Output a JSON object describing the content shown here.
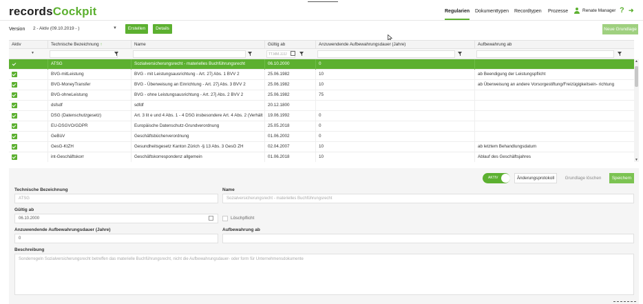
{
  "app": {
    "logo_part1": "records",
    "logo_part2": "Cockpit",
    "nav": [
      {
        "label": "Regularien",
        "active": true
      },
      {
        "label": "Dokumenttypen",
        "active": false
      },
      {
        "label": "Recordtypen",
        "active": false
      },
      {
        "label": "Prozesse",
        "active": false
      }
    ],
    "user_name": "Renate Manager"
  },
  "toolbar": {
    "version_label": "Version",
    "version_value": "2 - Aktiv (09.10.2019 - )",
    "create_label": "Erstellen",
    "details_label": "Details",
    "new_template_label": "Neue Grundlage"
  },
  "grid": {
    "columns": [
      {
        "label": "Aktiv"
      },
      {
        "label": "Technische Bezeichnung"
      },
      {
        "label": "Name"
      },
      {
        "label": "Gültig ab"
      },
      {
        "label": "Anzuwendende Aufbewahrungsdauer (Jahre)"
      },
      {
        "label": "Aufbewahrung ab"
      }
    ],
    "date_filter_placeholder": "TT.MM.JJJJ",
    "rows": [
      {
        "tech": "ATSG",
        "name": "Sozialversicherungsrecht - materielles Buchführungsrecht",
        "valid": "06.10.2000",
        "years": "0",
        "from": "",
        "selected": true
      },
      {
        "tech": "BVG-mitLeistung",
        "name": "BVG - mit Leistungsausrichtung - Art. 27j Abs. 1 BVV 2",
        "valid": "25.06.1982",
        "years": "10",
        "from": "ab Beendigung der Leistungspflicht",
        "selected": false
      },
      {
        "tech": "BVG-MoneyTransfer",
        "name": "BVG - Überweisung an Einrichtung - Art. 27j Abs. 3 BVV 2",
        "valid": "25.06.1982",
        "years": "10",
        "from": "ab Überweisung an andere Vorsorgestiftung/Freizügigkeitsein- richtung",
        "selected": false
      },
      {
        "tech": "BVG-ohneLeistung",
        "name": "BVG - ohne Leistungsausrichtung - Art. 27j Abs. 2 BVV 2",
        "valid": "25.06.1982",
        "years": "75",
        "from": "",
        "selected": false
      },
      {
        "tech": "dsfsdf",
        "name": "sdfdf",
        "valid": "20.12.1800",
        "years": "",
        "from": "",
        "selected": false
      },
      {
        "tech": "DSG (Datenschutzgesetz)",
        "name": "Art. 3 lit e und 4 Abs. 1 - 4 DSG insbesondere Art. 4 Abs. 2 (Verhält",
        "valid": "19.06.1992",
        "years": "0",
        "from": "",
        "selected": false
      },
      {
        "tech": "EU-DSGVO/GDPR",
        "name": "Europäische Datenschutz-Grundverordnung",
        "valid": "25.05.2018",
        "years": "0",
        "from": "",
        "selected": false
      },
      {
        "tech": "GeBüV",
        "name": "Geschäftsbücherverordnung",
        "valid": "01.06.2002",
        "years": "0",
        "from": "",
        "selected": false
      },
      {
        "tech": "GesG-KtZH",
        "name": "Gesundheitsgesetz Kanton Zürich -§ 13 Abs. 3 GesG ZH",
        "valid": "02.04.2007",
        "years": "10",
        "from": "ab letztem Behandlungsdatum",
        "selected": false
      },
      {
        "tech": "int-Geschäftskorr",
        "name": "Geschäftskorrespondenz allgemein",
        "valid": "01.06.2018",
        "years": "10",
        "from": "Ablauf des Geschäftsjahres",
        "selected": false
      }
    ]
  },
  "detail": {
    "toggle_label": "AKTIV",
    "protocol_label": "Änderungsprotokoll",
    "delete_label": "Grundlage löschen",
    "save_label": "Speichern",
    "tech_label": "Technische Bezeichnung",
    "tech_value": "ATSG",
    "name_label": "Name",
    "name_value": "Sozialversicherungsrecht - materielles Buchführungsrecht",
    "valid_label": "Gültig ab",
    "valid_value": "06.10.2000",
    "delete_duty_label": "Löschpflicht",
    "years_label": "Anzuwendende Aufbewahrungsdauer (Jahre)",
    "years_value": "0",
    "from_label": "Aufbewahrung ab",
    "from_value": "",
    "desc_label": "Beschreibung",
    "desc_value": "Sonderregeln Sozialversicherungsrecht betreffen das materielle Buchführungsrecht, nicht die Aufbewahrungsdauer- oder form für Unternehmensdokumente"
  }
}
